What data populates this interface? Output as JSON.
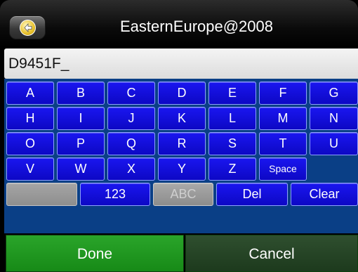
{
  "header": {
    "title": "EasternEurope@2008",
    "back_icon": "back-arrow-icon"
  },
  "input": {
    "value": "D9451F_"
  },
  "keyboard": {
    "rows": [
      [
        "A",
        "B",
        "C",
        "D",
        "E",
        "F",
        "G"
      ],
      [
        "H",
        "I",
        "J",
        "K",
        "L",
        "M",
        "N"
      ],
      [
        "O",
        "P",
        "Q",
        "R",
        "S",
        "T",
        "U"
      ],
      [
        "V",
        "W",
        "X",
        "Y",
        "Z",
        "Space"
      ]
    ],
    "mode_123": "123",
    "mode_abc": "ABC",
    "del": "Del",
    "clear": "Clear"
  },
  "actions": {
    "done": "Done",
    "cancel": "Cancel"
  },
  "colors": {
    "key_blue": "#130ee0",
    "keyboard_bg": "#0a3f86",
    "done_green": "#21991f",
    "cancel_green": "#264626"
  }
}
